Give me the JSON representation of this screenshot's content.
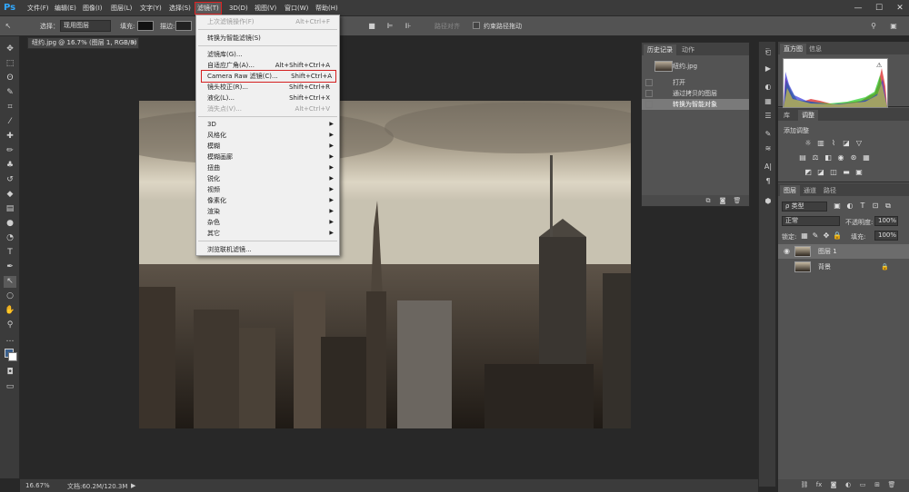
{
  "app": {
    "logo": "Ps"
  },
  "menubar": {
    "items": [
      "文件(F)",
      "编辑(E)",
      "图像(I)",
      "图层(L)",
      "文字(Y)",
      "选择(S)",
      "滤镜(T)",
      "3D(D)",
      "视图(V)",
      "窗口(W)",
      "帮助(H)"
    ],
    "active_index": 6,
    "window_controls": [
      "—",
      "☐",
      "✕"
    ]
  },
  "options": {
    "select_label": "选择：",
    "select_value": "现用图层",
    "fill_label": "填充:",
    "stroke_label": "描边:",
    "path_ops_label": "路径对齐",
    "constrain_label": "约束路径拖动",
    "search_icon": "search-icon",
    "workspace_icon": "workspace-icon"
  },
  "document": {
    "tab_label": "纽约.jpg @ 16.7% (图层 1, RGB/8) *",
    "close": "×"
  },
  "filter_menu": {
    "items": [
      {
        "label": "上次滤镜操作(F)",
        "shortcut": "Alt+Ctrl+F",
        "disabled": true
      },
      {
        "sep": true
      },
      {
        "label": "转换为智能滤镜(S)",
        "shortcut": "",
        "disabled": false
      },
      {
        "sep": true
      },
      {
        "label": "滤镜库(G)...",
        "shortcut": "",
        "disabled": false
      },
      {
        "label": "自适应广角(A)...",
        "shortcut": "Alt+Shift+Ctrl+A",
        "disabled": false
      },
      {
        "label": "Camera Raw 滤镜(C)...",
        "shortcut": "Shift+Ctrl+A",
        "disabled": false,
        "highlight": true
      },
      {
        "label": "镜头校正(R)...",
        "shortcut": "Shift+Ctrl+R",
        "disabled": false
      },
      {
        "label": "液化(L)...",
        "shortcut": "Shift+Ctrl+X",
        "disabled": false
      },
      {
        "label": "消失点(V)...",
        "shortcut": "Alt+Ctrl+V",
        "disabled": true
      },
      {
        "sep": true
      },
      {
        "label": "3D",
        "submenu": true
      },
      {
        "label": "风格化",
        "submenu": true
      },
      {
        "label": "模糊",
        "submenu": true
      },
      {
        "label": "模糊画廊",
        "submenu": true
      },
      {
        "label": "扭曲",
        "submenu": true
      },
      {
        "label": "锐化",
        "submenu": true
      },
      {
        "label": "视频",
        "submenu": true
      },
      {
        "label": "像素化",
        "submenu": true
      },
      {
        "label": "渲染",
        "submenu": true
      },
      {
        "label": "杂色",
        "submenu": true
      },
      {
        "label": "其它",
        "submenu": true
      },
      {
        "sep": true
      },
      {
        "label": "浏览联机滤镜...",
        "shortcut": "",
        "disabled": false
      }
    ]
  },
  "history_panel": {
    "tabs": [
      "历史记录",
      "动作"
    ],
    "snapshot": "纽约.jpg",
    "states": [
      "打开",
      "通过拷贝的图层",
      "转换为智能对象"
    ],
    "selected_index": 2
  },
  "histogram_panel": {
    "tabs": [
      "直方图",
      "信息"
    ]
  },
  "adjustments_panel": {
    "tabs": [
      "库",
      "调整"
    ],
    "title": "添加调整"
  },
  "layers_panel": {
    "tabs": [
      "图层",
      "通道",
      "路径"
    ],
    "filter_label": "ρ 类型",
    "blend_mode": "正常",
    "opacity_label": "不透明度:",
    "opacity_value": "100%",
    "lock_label": "锁定:",
    "fill_label": "填充:",
    "fill_value": "100%",
    "layers": [
      {
        "name": "图层 1",
        "visible": true,
        "selected": true,
        "locked": false
      },
      {
        "name": "背景",
        "visible": false,
        "selected": false,
        "locked": true
      }
    ]
  },
  "status": {
    "zoom": "16.67%",
    "doc_info": "文档:60.2M/120.3M"
  }
}
